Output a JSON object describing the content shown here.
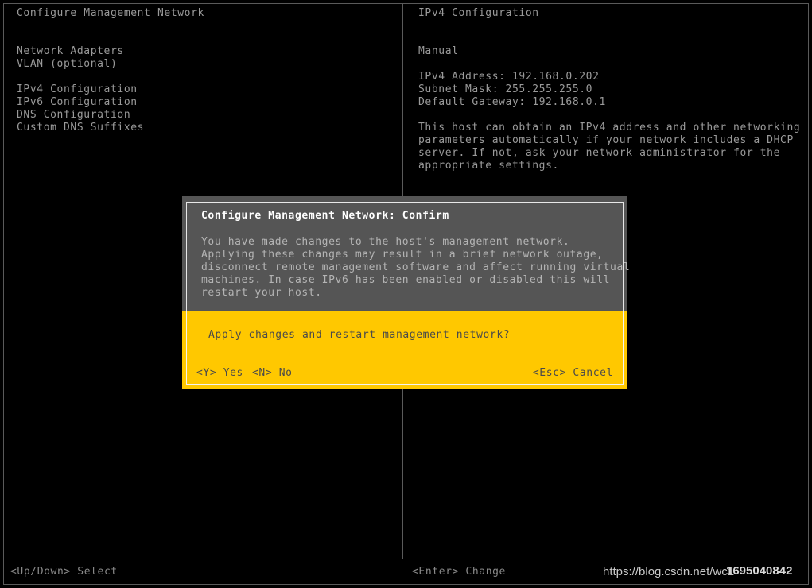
{
  "colors": {
    "background": "#000000",
    "frame_border": "#5a5a5a",
    "text": "#9a9a9a",
    "dialog_gray": "#555555",
    "dialog_yellow": "#ffc800",
    "dialog_title_text": "#ffffff",
    "dialog_body_text": "#b4b4b4",
    "dialog_yellow_text": "#4a4a4a"
  },
  "left_panel": {
    "title": "Configure Management Network",
    "menu_items": [
      {
        "label": "Network Adapters"
      },
      {
        "label": "VLAN (optional)"
      },
      {
        "label": "IPv4 Configuration"
      },
      {
        "label": "IPv6 Configuration"
      },
      {
        "label": "DNS Configuration"
      },
      {
        "label": "Custom DNS Suffixes"
      }
    ]
  },
  "right_panel": {
    "title": "IPv4 Configuration",
    "mode": "Manual",
    "fields": [
      {
        "label": "IPv4 Address:",
        "value": "192.168.0.202",
        "line": "IPv4 Address: 192.168.0.202"
      },
      {
        "label": "Subnet Mask:",
        "value": "255.255.255.0",
        "line": "Subnet Mask: 255.255.255.0"
      },
      {
        "label": "Default Gateway:",
        "value": "192.168.0.1",
        "line": "Default Gateway: 192.168.0.1"
      }
    ],
    "description_lines": [
      "This host can obtain an IPv4 address and other networking",
      "parameters automatically if your network includes a DHCP",
      "server. If not, ask your network administrator for the",
      "appropriate settings."
    ]
  },
  "dialog": {
    "title": "Configure Management Network: Confirm",
    "body_lines": [
      "You have made changes to the host's management network.",
      "Applying these changes may result in a brief network outage,",
      "disconnect remote management software and affect running virtual",
      "machines. In case IPv6 has been enabled or disabled this will",
      "restart your host."
    ],
    "question": "Apply changes and restart management network?",
    "actions": {
      "yes": "<Y> Yes",
      "no": "<N> No",
      "cancel": "<Esc> Cancel"
    }
  },
  "footer": {
    "select_hint": "<Up/Down> Select",
    "change_hint": "<Enter> Change"
  },
  "watermark": {
    "url": "https://blog.csdn.net/wc1",
    "id": "1695040842"
  }
}
